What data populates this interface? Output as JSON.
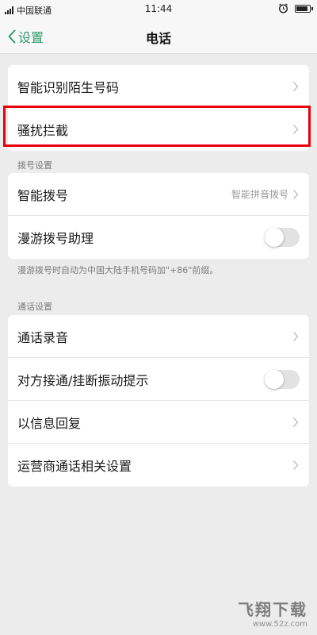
{
  "status_bar": {
    "carrier": "中国联通",
    "time": "11:44"
  },
  "nav": {
    "back_label": "设置",
    "title": "电话"
  },
  "group1": {
    "items": [
      {
        "label": "智能识别陌生号码"
      },
      {
        "label": "骚扰拦截"
      }
    ]
  },
  "dial_section": {
    "header": "拨号设置",
    "items": [
      {
        "label": "智能拨号",
        "value": "智能拼音拨号"
      },
      {
        "label": "漫游拨号助理",
        "toggle": false
      }
    ],
    "note": "漫游拨号时自动为中国大陆手机号码加\"+86\"前缀。"
  },
  "call_section": {
    "header": "通话设置",
    "items": [
      {
        "label": "通话录音"
      },
      {
        "label": "对方接通/挂断振动提示",
        "toggle": false
      },
      {
        "label": "以信息回复"
      },
      {
        "label": "运营商通话相关设置"
      }
    ]
  },
  "watermark": {
    "main": "飞翔下载",
    "sub": "www.52z.com"
  },
  "colors": {
    "accent": "#2f9b6e",
    "highlight": "#e8000b"
  }
}
